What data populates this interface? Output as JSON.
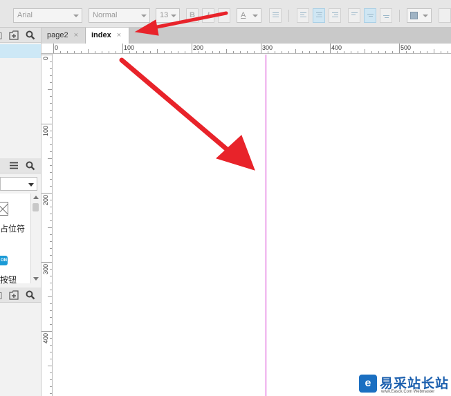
{
  "toolbar": {
    "font_family": "Arial",
    "font_style": "Normal",
    "font_size": "13",
    "bold_label": "B",
    "italic_label": "I",
    "font_color_label": "A"
  },
  "tabs": [
    {
      "label": "page2",
      "close": "×",
      "active": false
    },
    {
      "label": "index",
      "close": "×",
      "active": true
    }
  ],
  "ruler": {
    "horizontal": [
      "0",
      "100",
      "200",
      "300",
      "400",
      "500"
    ],
    "vertical": [
      "0",
      "100",
      "200",
      "300",
      "400"
    ]
  },
  "library": {
    "placeholder_label": "占位符",
    "button_chip": "ON",
    "button_label": "按钮"
  },
  "guide_color": "#d21fcb",
  "arrow_color": "#e8232a",
  "watermark": {
    "logo": "e",
    "text": "易采站长站",
    "url": "www.Easck.Com Webmaster"
  }
}
